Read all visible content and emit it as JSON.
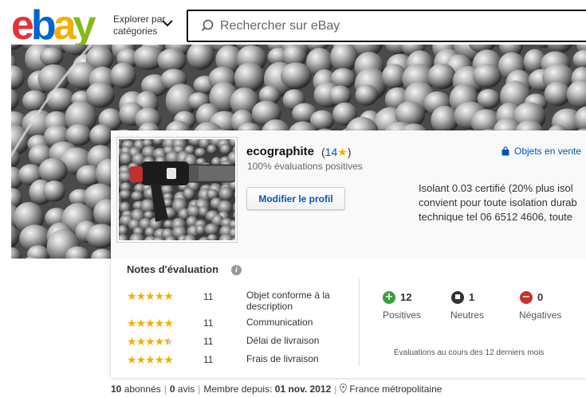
{
  "header": {
    "logo": {
      "e": "e",
      "b": "b",
      "a": "a",
      "y": "y"
    },
    "shop_by_line1": "Explorer par",
    "shop_by_line2": "catégories",
    "search_placeholder": "Rechercher sur eBay"
  },
  "seller": {
    "name": "ecographite",
    "score_open": "(",
    "score": "14",
    "score_close": ")",
    "positive_pct": "100% évaluations positives",
    "edit_profile_label": "Modifier le profil",
    "items_for_sale_label": "Objets en vente",
    "description_lines": [
      "Isolant 0.03 certifié (20% plus isol",
      "convient pour toute isolation durab",
      "technique tel 06 6512 4606, toute"
    ]
  },
  "ratings": {
    "title": "Notes d'évaluation",
    "info_glyph": "i",
    "rows": [
      {
        "label": "Objet conforme à la description",
        "count": "11",
        "stars": 5
      },
      {
        "label": "Communication",
        "count": "11",
        "stars": 5
      },
      {
        "label": "Délai de livraison",
        "count": "11",
        "stars": 4.5
      },
      {
        "label": "Frais de livraison",
        "count": "11",
        "stars": 5
      }
    ]
  },
  "feedback": {
    "positive": {
      "count": "12",
      "label": "Positives",
      "glyph": "+",
      "color": "#3a9e3a"
    },
    "neutral": {
      "count": "1",
      "label": "Neutres",
      "glyph": "■",
      "color": "#333333"
    },
    "negative": {
      "count": "0",
      "label": "Négatives",
      "glyph": "−",
      "color": "#c9302c"
    },
    "note": "Évaluations au cours des 12 derniers mois"
  },
  "footer": {
    "followers_count": "10",
    "followers_label": "abonnés",
    "reviews_count": "0",
    "reviews_label": "avis",
    "member_since_label": "Membre depuis:",
    "member_since_date": "01 nov. 2012",
    "location": "France métropolitaine"
  },
  "colors": {
    "link_blue": "#0654ba",
    "star_gold": "#f5af02"
  }
}
